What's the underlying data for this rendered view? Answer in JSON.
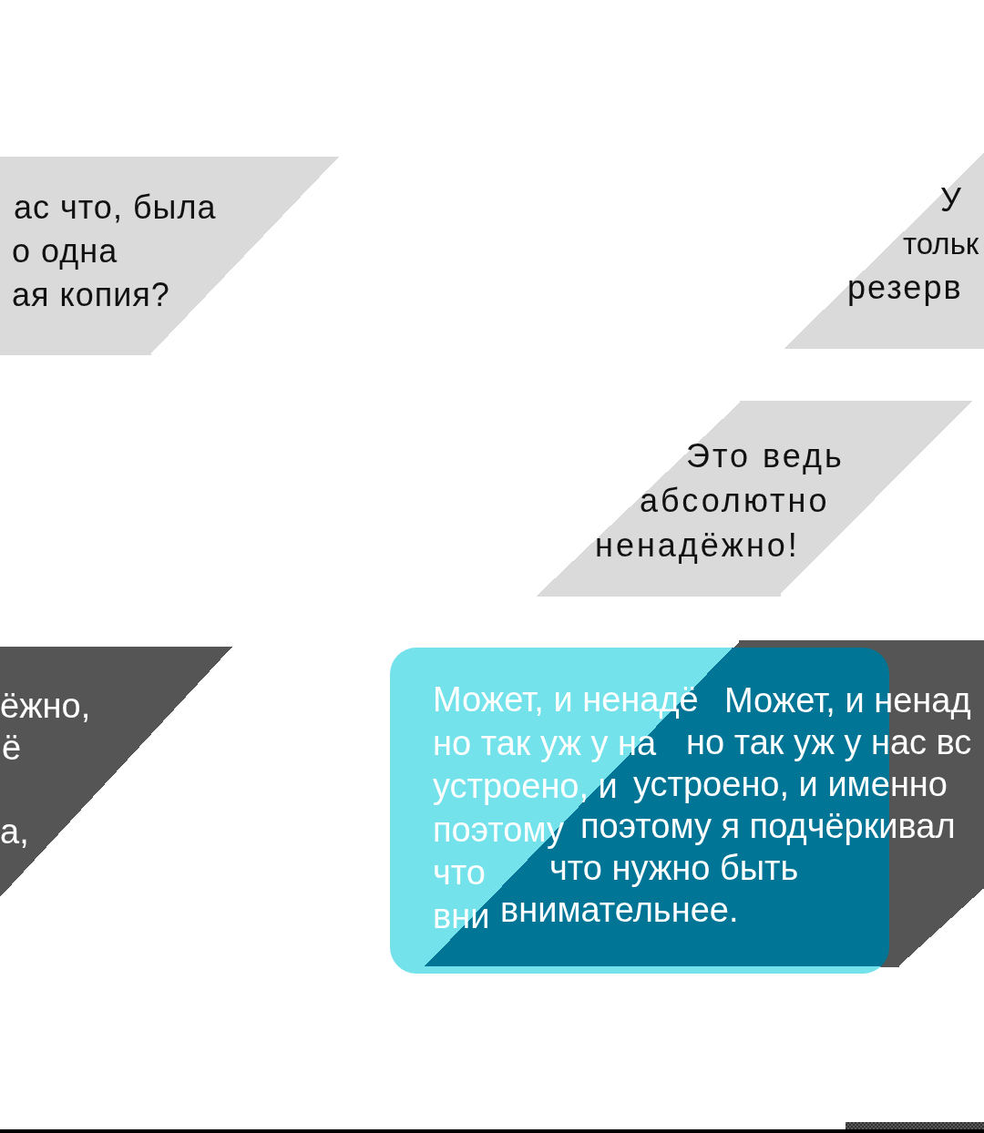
{
  "bubbles": [
    {
      "kind": "gray",
      "lines": [
        "ас что, была",
        "о одна",
        "ая копия?"
      ]
    },
    {
      "kind": "gray",
      "lines": [
        "У",
        "тольк",
        "резерв"
      ]
    },
    {
      "kind": "gray",
      "lines": [
        "Это ведь",
        "абсолютно",
        "ненадёжно!"
      ]
    },
    {
      "kind": "dark",
      "lines": [
        "ёжно,",
        "ё",
        "а,"
      ]
    },
    {
      "kind": "cyan",
      "lines": [
        "Может, и ненадё",
        "но так уж у на",
        "устроено, и",
        "поэтому",
        "что",
        "вни"
      ]
    },
    {
      "kind": "dark",
      "lines": [
        "Может, и ненад",
        "но так уж у нас вс",
        "устроено, и именно",
        "поэтому я подчёркивал",
        "что нужно быть",
        "внимательнее."
      ]
    }
  ]
}
